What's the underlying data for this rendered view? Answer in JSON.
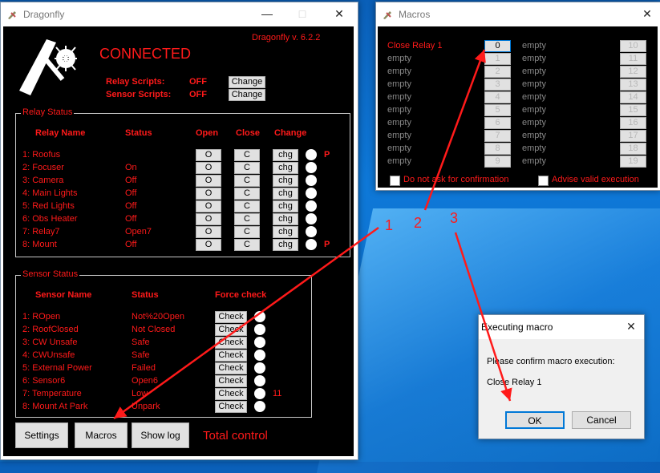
{
  "main_window": {
    "title": "Dragonfly",
    "version": "Dragonfly v. 6.2.2",
    "status": "CONNECTED",
    "relay_scripts_label": "Relay Scripts:",
    "relay_scripts_value": "OFF",
    "sensor_scripts_label": "Sensor Scripts:",
    "sensor_scripts_value": "OFF",
    "change_label": "Change",
    "relay_group_title": "Relay Status",
    "relay_headers": {
      "name": "Relay Name",
      "status": "Status",
      "open": "Open",
      "close": "Close",
      "change": "Change"
    },
    "open_btn": "O",
    "close_btn": "C",
    "chg_btn": "chg",
    "relays": [
      {
        "name": "1:  Roofus",
        "status": "",
        "flag": "P"
      },
      {
        "name": "2:  Focuser",
        "status": "On",
        "flag": ""
      },
      {
        "name": "3:  Camera",
        "status": "Off",
        "flag": ""
      },
      {
        "name": "4:  Main Lights",
        "status": "Off",
        "flag": ""
      },
      {
        "name": "5:  Red Lights",
        "status": "Off",
        "flag": ""
      },
      {
        "name": "6:  Obs Heater",
        "status": "Off",
        "flag": ""
      },
      {
        "name": "7:  Relay7",
        "status": "Open7",
        "flag": ""
      },
      {
        "name": "8:  Mount",
        "status": "Off",
        "flag": "P"
      }
    ],
    "sensor_group_title": "Sensor Status",
    "sensor_headers": {
      "name": "Sensor Name",
      "status": "Status",
      "force": "Force check"
    },
    "check_btn": "Check",
    "sensors": [
      {
        "name": "1:  ROpen",
        "status": "Not%20Open",
        "extra": ""
      },
      {
        "name": "2:  RoofClosed",
        "status": "Not Closed",
        "extra": ""
      },
      {
        "name": "3:  CW Unsafe",
        "status": "Safe",
        "extra": ""
      },
      {
        "name": "4:  CWUnsafe",
        "status": "Safe",
        "extra": ""
      },
      {
        "name": "5:  External Power",
        "status": "Failed",
        "extra": ""
      },
      {
        "name": "6:  Sensor6",
        "status": "Open6",
        "extra": ""
      },
      {
        "name": "7:  Temperature",
        "status": "Low",
        "extra": "11"
      },
      {
        "name": "8:  Mount At Park",
        "status": "Unpark",
        "extra": ""
      }
    ],
    "settings_btn": "Settings",
    "macros_btn": "Macros",
    "showlog_btn": "Show log",
    "footer_text": "Total control"
  },
  "macros_window": {
    "title": "Macros",
    "left": [
      {
        "label": "Close Relay 1",
        "num": "0"
      },
      {
        "label": "empty",
        "num": "1"
      },
      {
        "label": "empty",
        "num": "2"
      },
      {
        "label": "empty",
        "num": "3"
      },
      {
        "label": "empty",
        "num": "4"
      },
      {
        "label": "empty",
        "num": "5"
      },
      {
        "label": "empty",
        "num": "6"
      },
      {
        "label": "empty",
        "num": "7"
      },
      {
        "label": "empty",
        "num": "8"
      },
      {
        "label": "empty",
        "num": "9"
      }
    ],
    "right": [
      {
        "label": "empty",
        "num": "10"
      },
      {
        "label": "empty",
        "num": "11"
      },
      {
        "label": "empty",
        "num": "12"
      },
      {
        "label": "empty",
        "num": "13"
      },
      {
        "label": "empty",
        "num": "14"
      },
      {
        "label": "empty",
        "num": "15"
      },
      {
        "label": "empty",
        "num": "16"
      },
      {
        "label": "empty",
        "num": "17"
      },
      {
        "label": "empty",
        "num": "18"
      },
      {
        "label": "empty",
        "num": "19"
      }
    ],
    "no_confirm_label": "Do not ask for confirmation",
    "advise_label": "Advise valid execution"
  },
  "exec_dialog": {
    "title": "Executing macro",
    "message": "Please confirm macro execution:",
    "macro_name": "Close Relay 1",
    "ok_label": "OK",
    "cancel_label": "Cancel"
  },
  "annotations": {
    "step1": "1",
    "step2": "2",
    "step3": "3"
  },
  "colors": {
    "accent_red": "#ff1a1a",
    "panel_bg": "#000000",
    "desktop_blue": "#0e78d8"
  }
}
